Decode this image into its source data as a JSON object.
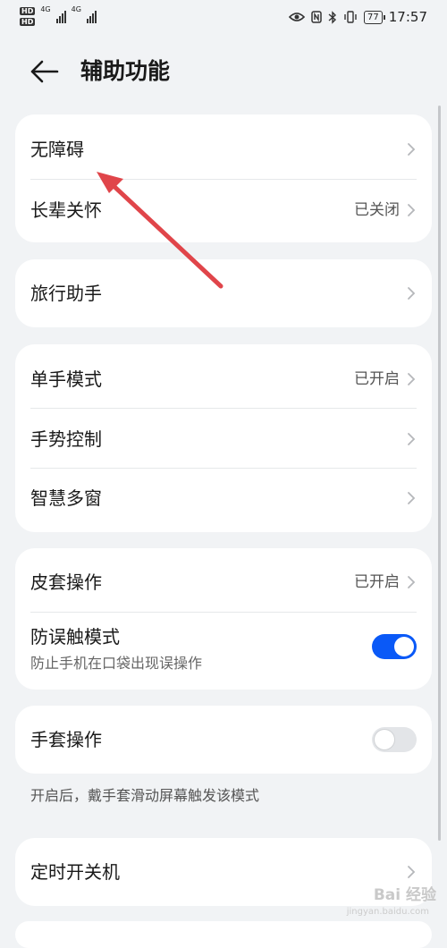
{
  "status_bar": {
    "time": "17:57",
    "battery": "77",
    "hd1": "HD",
    "hd2": "HD",
    "net1": "4G",
    "net2": "4G"
  },
  "header": {
    "title": "辅助功能",
    "back_icon": "arrow-left-icon"
  },
  "groups": [
    {
      "items": [
        {
          "label": "无障碍",
          "value": ""
        },
        {
          "label": "长辈关怀",
          "value": "已关闭"
        }
      ]
    },
    {
      "items": [
        {
          "label": "旅行助手",
          "value": ""
        }
      ]
    },
    {
      "items": [
        {
          "label": "单手模式",
          "value": "已开启"
        },
        {
          "label": "手势控制",
          "value": ""
        },
        {
          "label": "智慧多窗",
          "value": ""
        }
      ]
    },
    {
      "items": [
        {
          "label": "皮套操作",
          "value": "已开启"
        },
        {
          "label": "防误触模式",
          "subtitle": "防止手机在口袋出现误操作",
          "toggle": true
        }
      ]
    },
    {
      "items": [
        {
          "label": "手套操作",
          "toggle": false
        }
      ],
      "note": "开启后，戴手套滑动屏幕触发该模式"
    },
    {
      "items": [
        {
          "label": "定时开关机",
          "value": ""
        }
      ]
    }
  ],
  "colors": {
    "accent": "#0a59f7",
    "annotation_arrow": "#e0454a",
    "background": "#f1f3f5"
  },
  "watermark": {
    "text": "Bai 经验",
    "sub": "jingyan.baidu.com"
  }
}
